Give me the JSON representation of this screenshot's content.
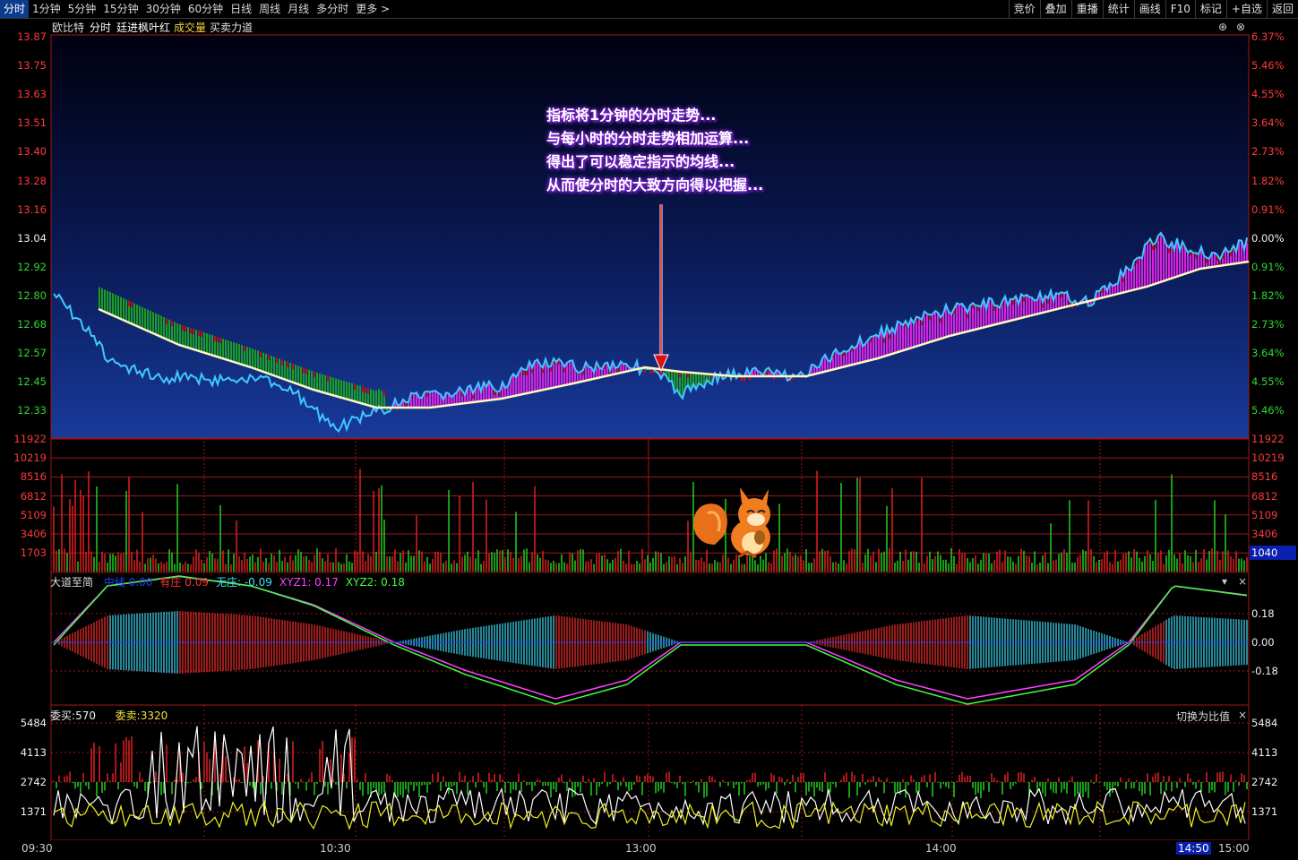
{
  "tabs": [
    "分时",
    "1分钟",
    "5分钟",
    "15分钟",
    "30分钟",
    "60分钟",
    "日线",
    "周线",
    "月线",
    "多分时",
    "更多 >"
  ],
  "tools": [
    "竞价",
    "叠加",
    "重播",
    "统计",
    "画线",
    "F10",
    "标记",
    "+自选",
    "返回"
  ],
  "header": {
    "stock": "欧比特",
    "mode": "分时",
    "indicator": "廷进枫叶红",
    "volume": "成交量",
    "flow": "买卖力道"
  },
  "price_axis": {
    "left": [
      "13.87",
      "13.75",
      "13.63",
      "13.51",
      "13.40",
      "13.28",
      "13.16",
      "13.04",
      "12.92",
      "12.80",
      "12.68",
      "12.57",
      "12.45",
      "12.33"
    ],
    "right": [
      "6.37%",
      "5.46%",
      "4.55%",
      "3.64%",
      "2.73%",
      "1.82%",
      "0.91%",
      "0.00%",
      "0.91%",
      "1.82%",
      "2.73%",
      "3.64%",
      "4.55%",
      "5.46%"
    ]
  },
  "volume_axis": [
    "11922",
    "10219",
    "8516",
    "6812",
    "5109",
    "3406",
    "1703"
  ],
  "volume_current": "1040",
  "annotation": [
    "指标将1分钟的分时走势...",
    "与每小时的分时走势相加运算...",
    "得出了可以稳定指示的均线...",
    "从而使分时的大致方向得以把握..."
  ],
  "indicator_panel": {
    "name": "大道至简",
    "items": [
      {
        "label": "中线",
        "value": "0.00",
        "color": "#2040ff"
      },
      {
        "label": "有庄",
        "value": "0.09",
        "color": "#ff3030"
      },
      {
        "label": "无庄",
        "value": "-0.09",
        "color": "#40e0ff"
      },
      {
        "label": "XYZ1",
        "value": "0.17",
        "color": "#ff40ff"
      },
      {
        "label": "XYZ2",
        "value": "0.18",
        "color": "#40ff40"
      }
    ],
    "axis": [
      "0.18",
      "0.00",
      "-0.18"
    ]
  },
  "order_panel": {
    "buy_label": "委买",
    "buy_value": "570",
    "sell_label": "委卖",
    "sell_value": "3320",
    "toggle": "切换为比值",
    "axis": [
      "5484",
      "4113",
      "2742",
      "1371"
    ]
  },
  "time_axis": [
    "09:30",
    "10:30",
    "13:00",
    "14:00",
    "14:50",
    "15:00"
  ]
}
